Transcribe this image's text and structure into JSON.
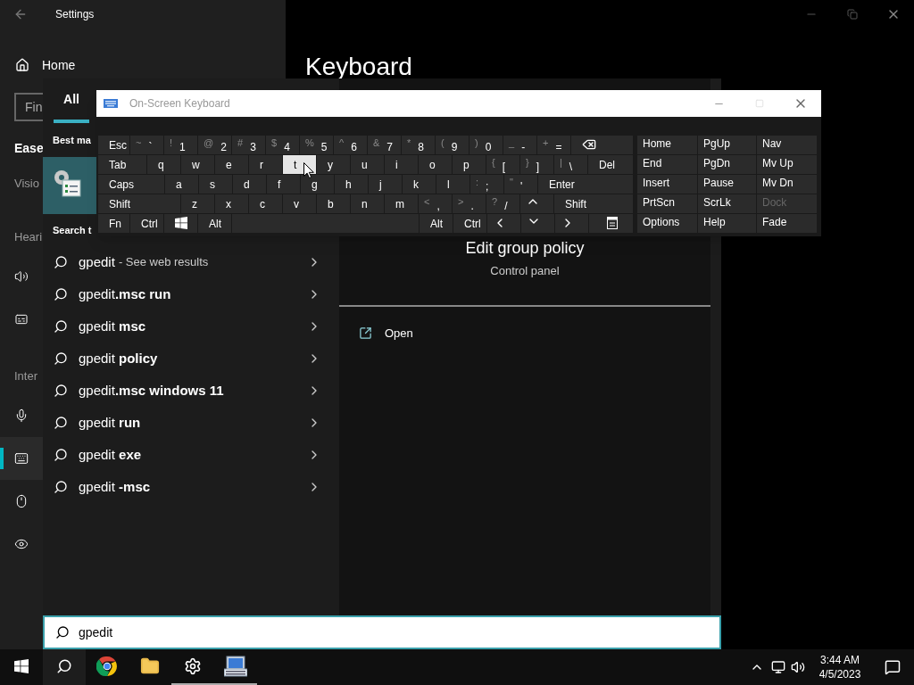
{
  "settings": {
    "title": "Settings",
    "home": "Home",
    "search_placeholder": "Fin",
    "heading": "Keyboard",
    "sections": [
      {
        "kind": "bold",
        "text": "Ease"
      },
      {
        "kind": "category",
        "text": "Visio"
      },
      {
        "kind": "category",
        "text": "Heari"
      },
      {
        "kind": "item",
        "selected": false
      },
      {
        "kind": "item",
        "selected": false
      },
      {
        "kind": "category",
        "text": "Inter"
      },
      {
        "kind": "item",
        "selected": false
      },
      {
        "kind": "item",
        "selected": true
      },
      {
        "kind": "item",
        "selected": false
      },
      {
        "kind": "item",
        "selected": false
      }
    ]
  },
  "search_panel": {
    "tabs": [
      {
        "label": "All",
        "selected": true
      }
    ],
    "best_match_label": "Best ma",
    "search_web_label": "Search t",
    "suggestions": [
      {
        "text": "gpedit",
        "note": "- See web results"
      },
      {
        "text": "gpedit**.msc run**"
      },
      {
        "text": "gpedit **msc**"
      },
      {
        "text": "gpedit **policy**"
      },
      {
        "text": "gpedit**.msc windows 11**"
      },
      {
        "text": "gpedit **run**"
      },
      {
        "text": "gpedit **exe**"
      },
      {
        "text": "gpedit **-msc**"
      }
    ],
    "detail": {
      "title": "Edit group policy",
      "subtitle": "Control panel",
      "actions": [
        {
          "label": "Open"
        }
      ]
    },
    "query": "gpedit"
  },
  "osk": {
    "title": "On-Screen Keyboard",
    "rows": [
      [
        {
          "kind": "text",
          "label": "Esc",
          "pressed": false
        },
        {
          "kind": "symbol",
          "shift": "~",
          "base": "`",
          "pressed": false
        },
        {
          "kind": "symbol",
          "shift": "!",
          "base": "1",
          "pressed": false
        },
        {
          "kind": "symbol",
          "shift": "@",
          "base": "2",
          "pressed": false
        },
        {
          "kind": "symbol",
          "shift": "#",
          "base": "3",
          "pressed": false
        },
        {
          "kind": "symbol",
          "shift": "$",
          "base": "4",
          "pressed": false
        },
        {
          "kind": "symbol",
          "shift": "%",
          "base": "5",
          "pressed": false
        },
        {
          "kind": "symbol",
          "shift": "^",
          "base": "6",
          "pressed": false
        },
        {
          "kind": "symbol",
          "shift": "&",
          "base": "7",
          "pressed": false
        },
        {
          "kind": "symbol",
          "shift": "*",
          "base": "8",
          "pressed": false
        },
        {
          "kind": "symbol",
          "shift": "(",
          "base": "9",
          "pressed": false
        },
        {
          "kind": "symbol",
          "shift": ")",
          "base": "0",
          "pressed": false
        },
        {
          "kind": "symbol",
          "shift": "_",
          "base": "-",
          "pressed": false
        },
        {
          "kind": "symbol",
          "shift": "+",
          "base": "=",
          "pressed": false
        },
        {
          "kind": "backspace",
          "pressed": false
        }
      ],
      [
        {
          "kind": "text",
          "label": "Tab",
          "pressed": false
        },
        {
          "kind": "text",
          "label": "q",
          "pressed": false
        },
        {
          "kind": "text",
          "label": "w",
          "pressed": false
        },
        {
          "kind": "text",
          "label": "e",
          "pressed": false
        },
        {
          "kind": "text",
          "label": "r",
          "pressed": false
        },
        {
          "kind": "text",
          "label": "t",
          "pressed": true
        },
        {
          "kind": "text",
          "label": "y",
          "pressed": false
        },
        {
          "kind": "text",
          "label": "u",
          "pressed": false
        },
        {
          "kind": "text",
          "label": "i",
          "pressed": false
        },
        {
          "kind": "text",
          "label": "o",
          "pressed": false
        },
        {
          "kind": "text",
          "label": "p",
          "pressed": false
        },
        {
          "kind": "symbol",
          "shift": "{",
          "base": "[",
          "pressed": false
        },
        {
          "kind": "symbol",
          "shift": "}",
          "base": "]",
          "pressed": false
        },
        {
          "kind": "symbol",
          "shift": "|",
          "base": "\\",
          "pressed": false
        },
        {
          "kind": "text",
          "label": "Del",
          "pressed": false
        }
      ],
      [
        {
          "kind": "text",
          "label": "Caps",
          "pressed": false
        },
        {
          "kind": "text",
          "label": "a",
          "pressed": false
        },
        {
          "kind": "text",
          "label": "s",
          "pressed": false
        },
        {
          "kind": "text",
          "label": "d",
          "pressed": false
        },
        {
          "kind": "text",
          "label": "f",
          "pressed": false
        },
        {
          "kind": "text",
          "label": "g",
          "pressed": false
        },
        {
          "kind": "text",
          "label": "h",
          "pressed": false
        },
        {
          "kind": "text",
          "label": "j",
          "pressed": false
        },
        {
          "kind": "text",
          "label": "k",
          "pressed": false
        },
        {
          "kind": "text",
          "label": "l",
          "pressed": false
        },
        {
          "kind": "symbol",
          "shift": ":",
          "base": ";",
          "pressed": false
        },
        {
          "kind": "symbol",
          "shift": "\"",
          "base": "'",
          "pressed": false
        },
        {
          "kind": "text",
          "label": "Enter",
          "pressed": false
        }
      ],
      [
        {
          "kind": "text",
          "label": "Shift",
          "pressed": false
        },
        {
          "kind": "text",
          "label": "z",
          "pressed": false
        },
        {
          "kind": "text",
          "label": "x",
          "pressed": false
        },
        {
          "kind": "text",
          "label": "c",
          "pressed": false
        },
        {
          "kind": "text",
          "label": "v",
          "pressed": false
        },
        {
          "kind": "text",
          "label": "b",
          "pressed": false
        },
        {
          "kind": "text",
          "label": "n",
          "pressed": false
        },
        {
          "kind": "text",
          "label": "m",
          "pressed": false
        },
        {
          "kind": "symbol",
          "shift": "<",
          "base": ",",
          "pressed": false
        },
        {
          "kind": "symbol",
          "shift": ">",
          "base": ".",
          "pressed": false
        },
        {
          "kind": "symbol",
          "shift": "?",
          "base": "/",
          "pressed": false
        },
        {
          "kind": "up",
          "pressed": false
        },
        {
          "kind": "text",
          "label": "Shift",
          "pressed": false
        }
      ],
      [
        {
          "kind": "text",
          "label": "Fn",
          "pressed": false
        },
        {
          "kind": "text",
          "label": "Ctrl",
          "pressed": false
        },
        {
          "kind": "windows",
          "pressed": false
        },
        {
          "kind": "text",
          "label": "Alt",
          "pressed": false
        },
        {
          "kind": "space",
          "pressed": false
        },
        {
          "kind": "text",
          "label": "Alt",
          "pressed": false
        },
        {
          "kind": "text",
          "label": "Ctrl",
          "pressed": false
        },
        {
          "kind": "left",
          "pressed": false
        },
        {
          "kind": "down",
          "pressed": false
        },
        {
          "kind": "right",
          "pressed": false
        },
        {
          "kind": "menu",
          "pressed": false
        }
      ]
    ],
    "nav_rows": [
      [
        {
          "label": "Home",
          "disabled": false
        },
        {
          "label": "PgUp",
          "disabled": false
        },
        {
          "label": "Nav",
          "disabled": false
        }
      ],
      [
        {
          "label": "End",
          "disabled": false
        },
        {
          "label": "PgDn",
          "disabled": false
        },
        {
          "label": "Mv Up",
          "disabled": false
        }
      ],
      [
        {
          "label": "Insert",
          "disabled": false
        },
        {
          "label": "Pause",
          "disabled": false
        },
        {
          "label": "Mv Dn",
          "disabled": false
        }
      ],
      [
        {
          "label": "PrtScn",
          "disabled": false
        },
        {
          "label": "ScrLk",
          "disabled": false
        },
        {
          "label": "Dock",
          "disabled": true
        }
      ],
      [
        {
          "label": "Options",
          "disabled": false
        },
        {
          "label": "Help",
          "disabled": false
        },
        {
          "label": "Fade",
          "disabled": false
        }
      ]
    ]
  },
  "taskbar": {
    "apps": [
      {
        "running": false
      },
      {
        "running": false
      },
      {
        "running": false
      },
      {
        "running": false
      },
      {
        "running": true
      },
      {
        "running": true
      }
    ],
    "time": "3:44 AM",
    "date": "4/5/2023"
  }
}
